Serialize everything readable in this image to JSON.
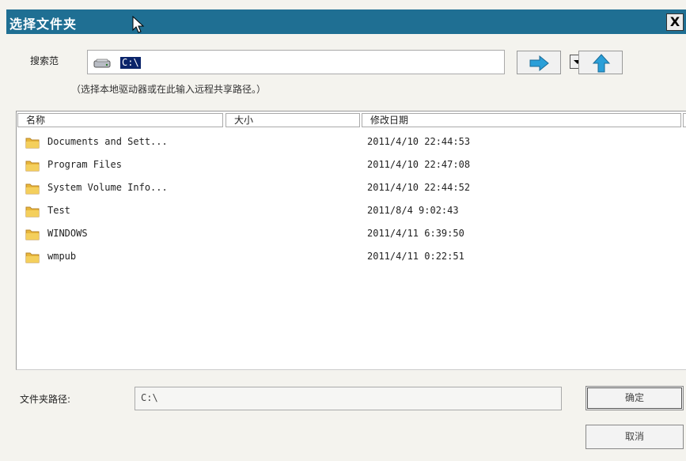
{
  "window": {
    "title": "选择文件夹",
    "close_glyph": "X"
  },
  "lookin": {
    "label": "搜索范",
    "drive_icon": "drive-icon",
    "value": "C:\\",
    "hint": "（选择本地驱动器或在此输入远程共享路径。）"
  },
  "nav": {
    "go_icon": "arrow-right-icon",
    "up_icon": "arrow-up-icon",
    "accent": "#2a9fd8"
  },
  "list": {
    "columns": [
      "名称",
      "大小",
      "修改日期"
    ],
    "items": [
      {
        "name": "Documents and Sett...",
        "size": "",
        "date": "2011/4/10 22:44:53"
      },
      {
        "name": "Program Files",
        "size": "",
        "date": "2011/4/10 22:47:08"
      },
      {
        "name": "System Volume Info...",
        "size": "",
        "date": "2011/4/10 22:44:52"
      },
      {
        "name": "Test",
        "size": "",
        "date": "2011/8/4 9:02:43"
      },
      {
        "name": "WINDOWS",
        "size": "",
        "date": "2011/4/11 6:39:50"
      },
      {
        "name": "wmpub",
        "size": "",
        "date": "2011/4/11 0:22:51"
      }
    ]
  },
  "folder_path": {
    "label": "文件夹路径:",
    "value": "C:\\"
  },
  "buttons": {
    "ok": "确定",
    "cancel": "取消"
  },
  "colors": {
    "titlebar": "#1f6f93",
    "selection": "#0a246a",
    "folder": "#e8b63a"
  }
}
